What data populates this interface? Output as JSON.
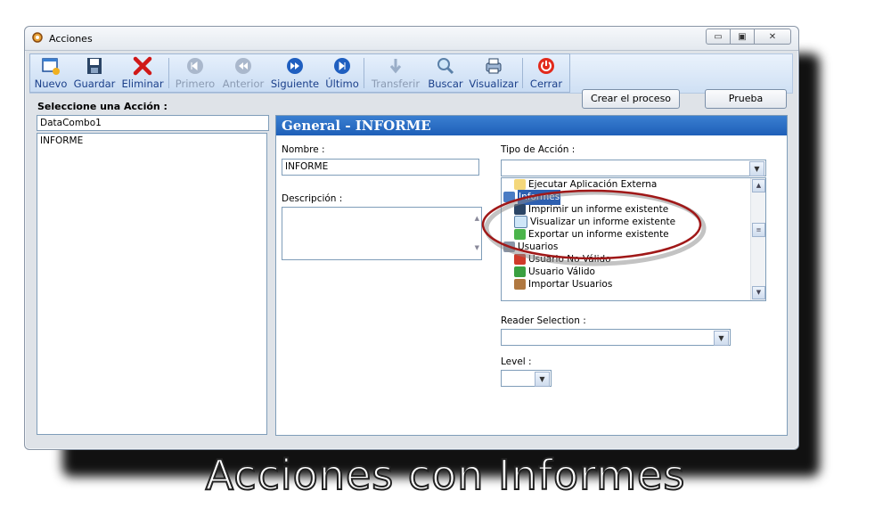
{
  "window": {
    "title": "Acciones"
  },
  "toolbar": {
    "nuevo": "Nuevo",
    "guardar": "Guardar",
    "eliminar": "Eliminar",
    "primero": "Primero",
    "anterior": "Anterior",
    "siguiente": "Siguiente",
    "ultimo": "Último",
    "transferir": "Transferir",
    "buscar": "Buscar",
    "visualizar": "Visualizar",
    "cerrar": "Cerrar"
  },
  "actions": {
    "crear_proceso": "Crear el proceso",
    "prueba": "Prueba"
  },
  "left": {
    "section_label": "Seleccione una Acción :",
    "combo_value": "DataCombo1",
    "items": [
      "INFORME"
    ]
  },
  "panel": {
    "header": "General - INFORME",
    "nombre_label": "Nombre :",
    "nombre_value": "INFORME",
    "descripcion_label": "Descripción :",
    "tipo_label": "Tipo de Acción :",
    "tree": [
      "Ejecutar Aplicación Externa",
      "Informes",
      "Imprimir un informe existente",
      "Visualizar un informe existente",
      "Exportar un informe existente",
      "Usuarios",
      "Usuario No Válido",
      "Usuario Válido",
      "Importar Usuarios"
    ],
    "reader_label": "Reader Selection :",
    "level_label": "Level :"
  },
  "caption": "Acciones con Informes",
  "colors": {
    "accent": "#1e5fb8",
    "highlight_ellipse": "#a01818"
  }
}
